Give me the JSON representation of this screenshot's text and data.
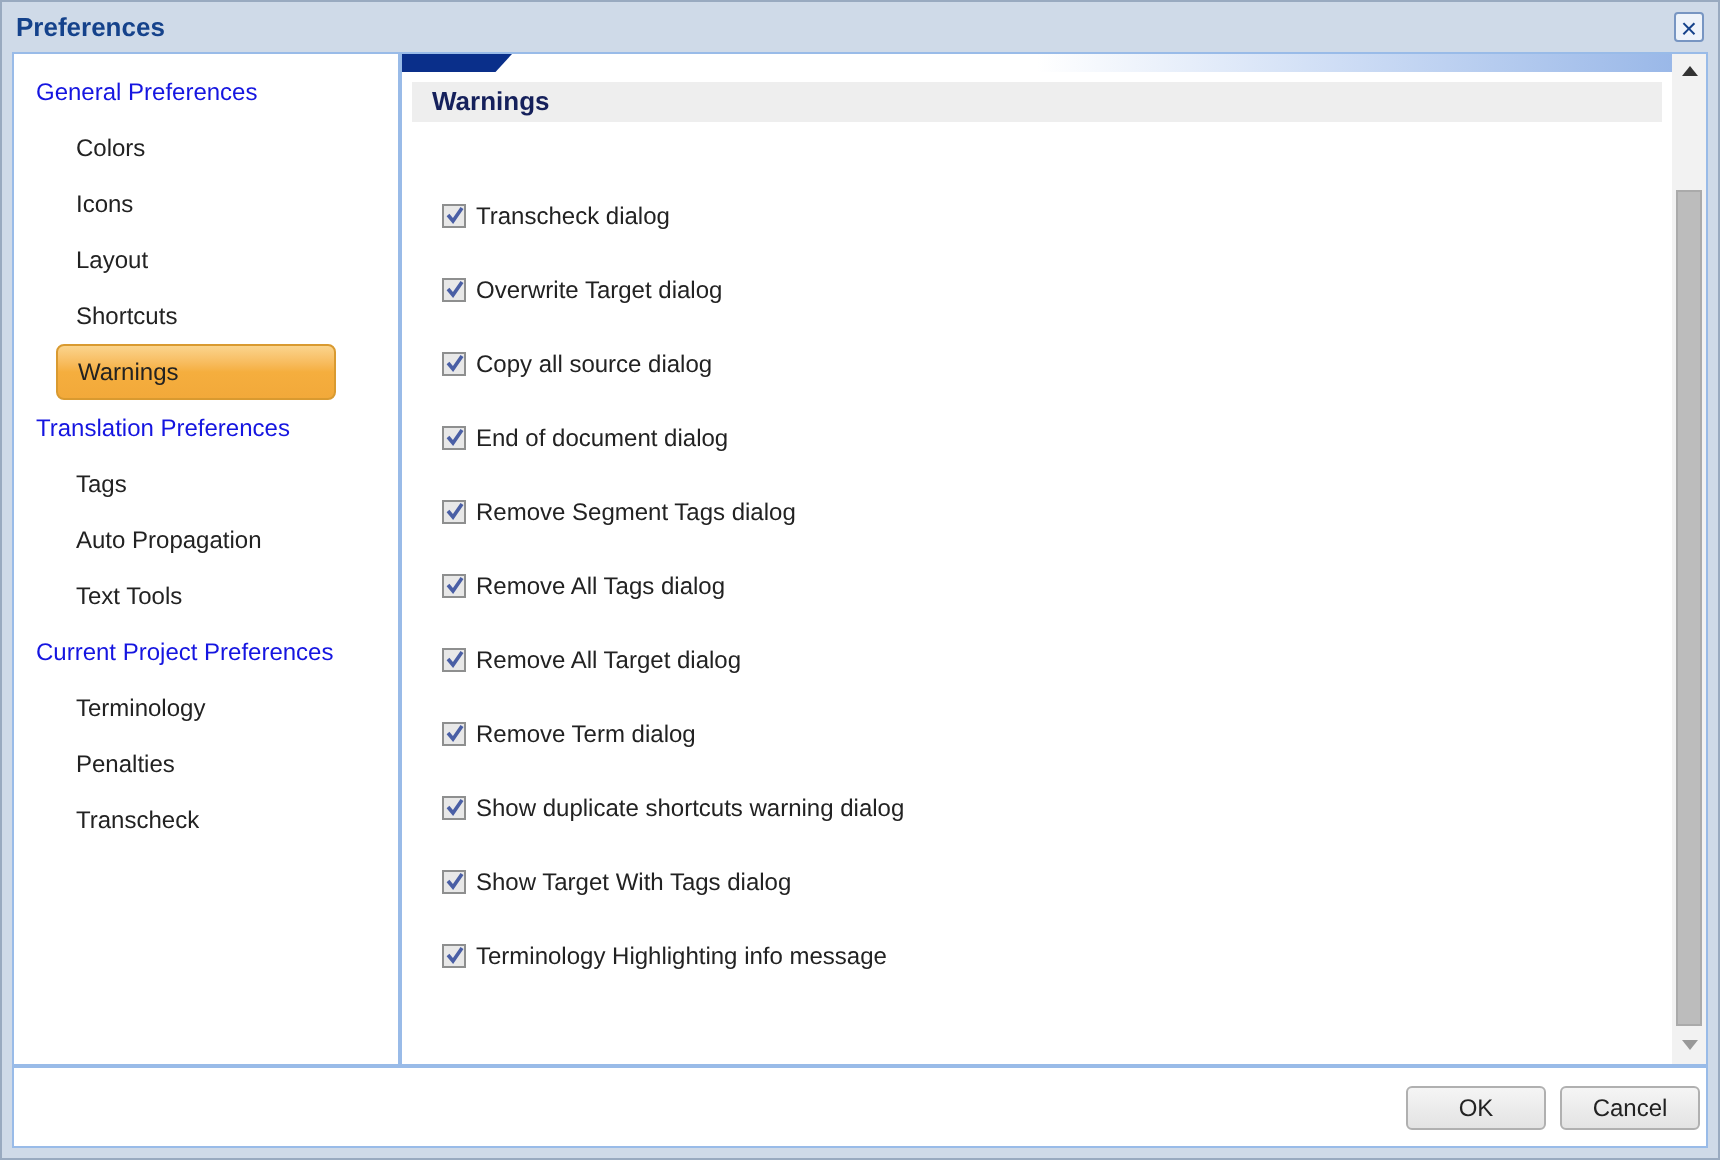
{
  "window": {
    "title": "Preferences",
    "close": "×"
  },
  "sidebar": {
    "groups": [
      {
        "label": "General Preferences",
        "children": [
          {
            "label": "Colors",
            "selected": false
          },
          {
            "label": "Icons",
            "selected": false
          },
          {
            "label": "Layout",
            "selected": false
          },
          {
            "label": "Shortcuts",
            "selected": false
          },
          {
            "label": "Warnings",
            "selected": true
          }
        ]
      },
      {
        "label": "Translation Preferences",
        "children": [
          {
            "label": "Tags",
            "selected": false
          },
          {
            "label": "Auto Propagation",
            "selected": false
          },
          {
            "label": "Text Tools",
            "selected": false
          }
        ]
      },
      {
        "label": "Current Project Preferences",
        "children": [
          {
            "label": "Terminology",
            "selected": false
          },
          {
            "label": "Penalties",
            "selected": false
          },
          {
            "label": "Transcheck",
            "selected": false
          }
        ]
      }
    ]
  },
  "panel": {
    "title": "Warnings",
    "options": [
      {
        "label": "Transcheck dialog",
        "checked": true
      },
      {
        "label": "Overwrite Target dialog",
        "checked": true
      },
      {
        "label": "Copy all source dialog",
        "checked": true
      },
      {
        "label": "End of document dialog",
        "checked": true
      },
      {
        "label": "Remove Segment Tags dialog",
        "checked": true
      },
      {
        "label": "Remove All Tags dialog",
        "checked": true
      },
      {
        "label": "Remove All Target dialog",
        "checked": true
      },
      {
        "label": "Remove Term dialog",
        "checked": true
      },
      {
        "label": "Show duplicate shortcuts warning dialog",
        "checked": true
      },
      {
        "label": "Show Target With Tags dialog",
        "checked": true
      },
      {
        "label": "Terminology Highlighting info message",
        "checked": true
      }
    ]
  },
  "buttons": [
    "OK",
    "Cancel"
  ]
}
